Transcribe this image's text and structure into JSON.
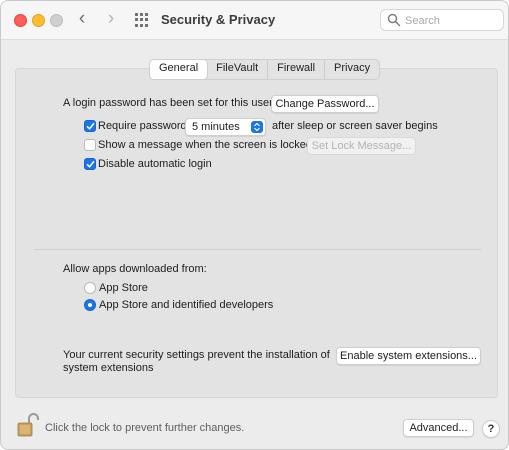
{
  "window": {
    "title": "Security & Privacy",
    "search_placeholder": "Search"
  },
  "tabs": [
    {
      "label": "General",
      "active": true
    },
    {
      "label": "FileVault",
      "active": false
    },
    {
      "label": "Firewall",
      "active": false
    },
    {
      "label": "Privacy",
      "active": false
    }
  ],
  "general": {
    "login_password_text": "A login password has been set for this user",
    "change_password_button": "Change Password...",
    "require_password": {
      "label": "Require password",
      "checked": true
    },
    "require_password_delay": "5 minutes",
    "require_password_suffix": "after sleep or screen saver begins",
    "show_message": {
      "label": "Show a message when the screen is locked",
      "checked": false
    },
    "set_lock_message_button": "Set Lock Message...",
    "disable_auto_login": {
      "label": "Disable automatic login",
      "checked": true
    },
    "allow_apps_label": "Allow apps downloaded from:",
    "allow_options": [
      {
        "label": "App Store",
        "selected": false
      },
      {
        "label": "App Store and identified developers",
        "selected": true
      }
    ],
    "security_notice_line1": "Your current security settings prevent the installation of",
    "security_notice_line2": "system extensions",
    "enable_extensions_button": "Enable system extensions..."
  },
  "footer": {
    "lock_text": "Click the lock to prevent further changes.",
    "advanced_button": "Advanced...",
    "help_button": "?"
  },
  "colors": {
    "accent": "#1b74e8",
    "close": "#fe5f57",
    "minimize": "#febc2e"
  }
}
